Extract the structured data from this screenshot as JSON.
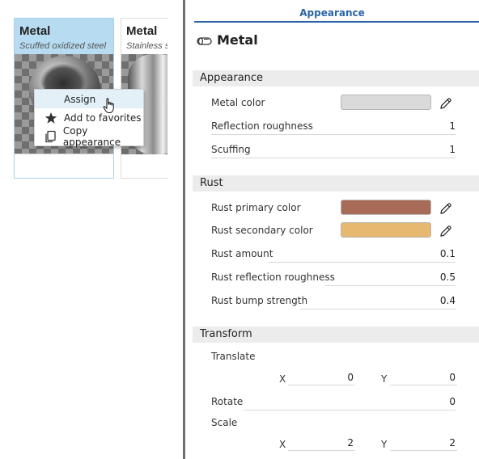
{
  "library": {
    "cards": [
      {
        "title": "Metal",
        "subtitle": "Scuffed oxidized steel"
      },
      {
        "title": "Metal",
        "subtitle": "Stainless steel"
      }
    ],
    "context_menu": {
      "items": [
        {
          "label": "Assign",
          "icon": "none"
        },
        {
          "label": "Add to favorites",
          "icon": "star-icon"
        },
        {
          "label": "Copy appearance",
          "icon": "copy-icon"
        }
      ]
    }
  },
  "panel": {
    "tab_label": "Appearance",
    "material_title": "Metal",
    "sections": {
      "appearance": "Appearance",
      "rust": "Rust",
      "transform": "Transform"
    },
    "appearance": {
      "metal_color_label": "Metal color",
      "metal_color_hex": "#dadada",
      "reflection_roughness_label": "Reflection roughness",
      "reflection_roughness_value": "1",
      "scuffing_label": "Scuffing",
      "scuffing_value": "1"
    },
    "rust": {
      "primary_color_label": "Rust primary color",
      "primary_color_hex": "#a86b58",
      "secondary_color_label": "Rust secondary color",
      "secondary_color_hex": "#e6b870",
      "amount_label": "Rust amount",
      "amount_value": "0.1",
      "reflection_roughness_label": "Rust reflection roughness",
      "reflection_roughness_value": "0.5",
      "bump_strength_label": "Rust bump strength",
      "bump_strength_value": "0.4"
    },
    "transform": {
      "translate_label": "Translate",
      "translate_x_axis": "X",
      "translate_x": "0",
      "translate_y_axis": "Y",
      "translate_y": "0",
      "rotate_label": "Rotate",
      "rotate_value": "0",
      "scale_label": "Scale",
      "scale_x_axis": "X",
      "scale_x": "2",
      "scale_y_axis": "Y",
      "scale_y": "2"
    }
  },
  "colors": {
    "accent": "#2a64a8",
    "selected_card": "#b7dcf1",
    "section_bg": "#ececec"
  }
}
